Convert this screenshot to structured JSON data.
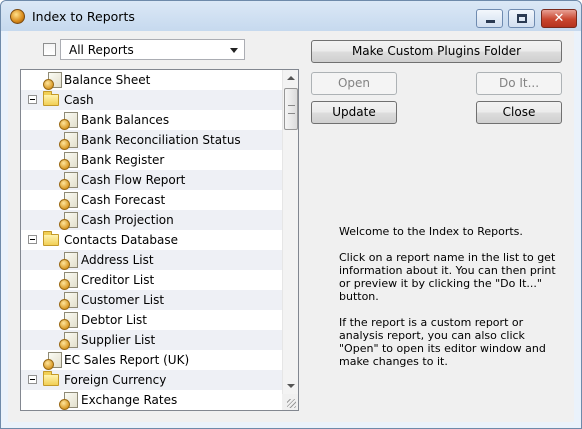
{
  "window": {
    "title": "Index to Reports",
    "close_glyph": "✕"
  },
  "filter": {
    "selected": "All Reports"
  },
  "tree": {
    "rows": [
      {
        "label": "Balance Sheet",
        "level": 0,
        "type": "report"
      },
      {
        "label": "Cash",
        "level": 0,
        "type": "folder",
        "expanded": true
      },
      {
        "label": "Bank Balances",
        "level": 1,
        "type": "report"
      },
      {
        "label": "Bank Reconciliation Status",
        "level": 1,
        "type": "report"
      },
      {
        "label": "Bank Register",
        "level": 1,
        "type": "report"
      },
      {
        "label": "Cash Flow Report",
        "level": 1,
        "type": "report"
      },
      {
        "label": "Cash Forecast",
        "level": 1,
        "type": "report"
      },
      {
        "label": "Cash Projection",
        "level": 1,
        "type": "report"
      },
      {
        "label": "Contacts Database",
        "level": 0,
        "type": "folder",
        "expanded": true
      },
      {
        "label": "Address List",
        "level": 1,
        "type": "report"
      },
      {
        "label": "Creditor List",
        "level": 1,
        "type": "report"
      },
      {
        "label": "Customer List",
        "level": 1,
        "type": "report"
      },
      {
        "label": "Debtor List",
        "level": 1,
        "type": "report"
      },
      {
        "label": "Supplier List",
        "level": 1,
        "type": "report"
      },
      {
        "label": "EC Sales Report (UK)",
        "level": 0,
        "type": "report"
      },
      {
        "label": "Foreign Currency",
        "level": 0,
        "type": "folder",
        "expanded": true
      },
      {
        "label": "Exchange Rates",
        "level": 1,
        "type": "report"
      }
    ]
  },
  "buttons": {
    "make_custom": "Make Custom Plugins Folder",
    "open": "Open",
    "do_it": "Do It...",
    "update": "Update",
    "close": "Close"
  },
  "info": {
    "p1": "Welcome to the Index to Reports.",
    "p2": "Click on a report name in the list to get information about it. You can then print or preview it by clicking the \"Do It...\" button.",
    "p3": "If the report is a custom report or analysis report, you can also click \"Open\" to open its editor window and make changes to it."
  }
}
